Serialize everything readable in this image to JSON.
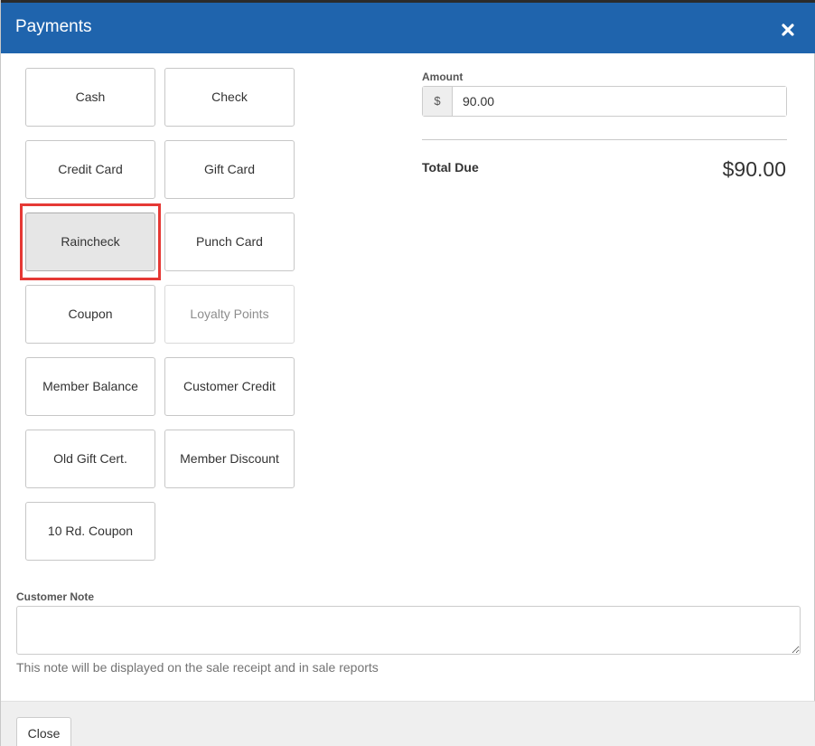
{
  "dialog": {
    "title": "Payments",
    "close_icon": "close-icon"
  },
  "payment_methods": [
    {
      "label": "Cash",
      "state": "normal"
    },
    {
      "label": "Check",
      "state": "normal"
    },
    {
      "label": "Credit Card",
      "state": "normal"
    },
    {
      "label": "Gift Card",
      "state": "normal"
    },
    {
      "label": "Raincheck",
      "state": "selected"
    },
    {
      "label": "Punch Card",
      "state": "normal"
    },
    {
      "label": "Coupon",
      "state": "normal"
    },
    {
      "label": "Loyalty Points",
      "state": "disabled"
    },
    {
      "label": "Member Balance",
      "state": "normal"
    },
    {
      "label": "Customer Credit",
      "state": "normal"
    },
    {
      "label": "Old Gift Cert.",
      "state": "normal"
    },
    {
      "label": "Member Discount",
      "state": "normal"
    },
    {
      "label": "10 Rd. Coupon",
      "state": "normal"
    }
  ],
  "amount": {
    "label": "Amount",
    "currency_symbol": "$",
    "value": "90.00"
  },
  "total": {
    "label": "Total Due",
    "value": "$90.00"
  },
  "customer_note": {
    "label": "Customer Note",
    "value": "",
    "help_text": "This note will be displayed on the sale receipt and in sale reports"
  },
  "footer": {
    "close_label": "Close"
  },
  "colors": {
    "header_bg": "#1f64ad",
    "highlight": "#e53935",
    "footer_bg": "#efefef"
  }
}
